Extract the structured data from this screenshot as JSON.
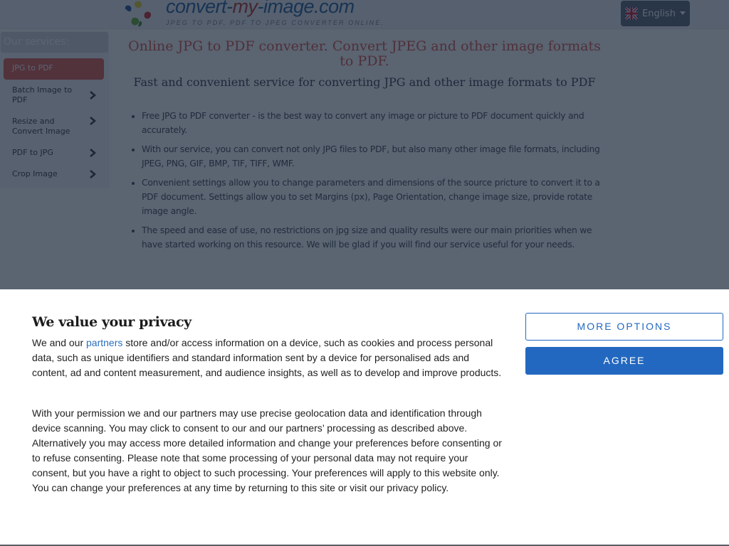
{
  "site": {
    "logo_text_part1": "convert-",
    "logo_text_part2": "my",
    "logo_text_part3": "-image.com",
    "tagline": "JPEG TO PDF, PDF TO JPEG CONVERTER ONLINE.",
    "logo_icon": "pinwheel-logo-icon"
  },
  "language": {
    "selected": "English",
    "flag_icon": "uk-flag-icon"
  },
  "sidebar": {
    "title": "Our services:",
    "items": [
      {
        "label": "JPG to PDF",
        "active": true
      },
      {
        "label": "Batch Image to PDF",
        "active": false
      },
      {
        "label": "Resize and Convert Image",
        "active": false
      },
      {
        "label": "PDF to JPG",
        "active": false
      },
      {
        "label": "Crop Image",
        "active": false
      }
    ]
  },
  "main": {
    "title": "Online JPG to PDF converter. Convert JPEG and other image formats to PDF.",
    "subtitle": "Fast and convenient service for converting JPG and other image formats to PDF",
    "features": [
      "Free JPG to PDF converter - is the best way to convert any image or picture to PDF document quickly and accurately.",
      "With our service, you can convert not only JPG files to PDF, but also many other image file formats, including JPEG, PNG, GIF, BMP, TIF, TIFF, WMF.",
      "Convenient settings allow you to change parameters and dimensions of the source pricture to convert it to a PDF document. Settings allow you to set Margins (px), Page Orientation, change image size, provide rotate image angle.",
      "The speed and ease of use, no restrictions on jpg size and quality results were our main priorities when we have started working on this resource. We will be glad if you will find our service useful for your needs."
    ]
  },
  "consent": {
    "heading": "We value your privacy",
    "p1_before": "We and our ",
    "p1_link": "partners",
    "p1_after": " store and/or access information on a device, such as cookies and process personal data, such as unique identifiers and standard information sent by a device for personalised ads and content, ad and content measurement, and audience insights, as well as to develop and improve products.",
    "p2": "With your permission we and our partners may use precise geolocation data and identification through device scanning. You may click to consent to our and our partners’ processing as described above. Alternatively you may access more detailed information and change your preferences before consenting or to refuse consenting. Please note that some processing of your personal data may not require your consent, but you have a right to object to such processing. Your preferences will apply to this website only. You can change your preferences at any time by returning to this site or visit our privacy policy.",
    "more_options_label": "MORE OPTIONS",
    "agree_label": "AGREE"
  },
  "colors": {
    "accent_red": "#e0584c",
    "brand_blue": "#2368c0",
    "overlay": "#162234"
  }
}
